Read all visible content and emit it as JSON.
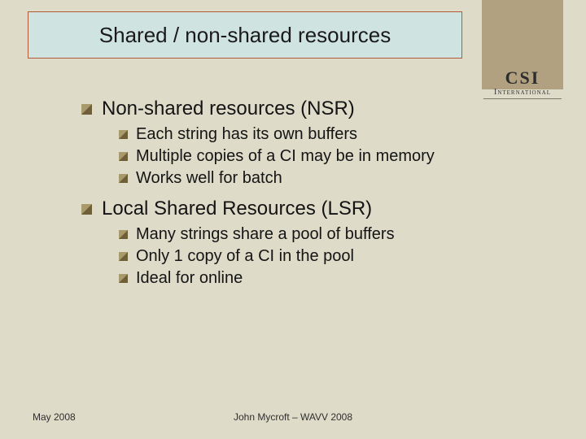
{
  "logo": {
    "main": "CSI",
    "sub": "International"
  },
  "title": "Shared / non-shared resources",
  "sections": [
    {
      "heading": "Non-shared resources (NSR)",
      "items": [
        "Each string has its own buffers",
        "Multiple copies of a CI may be in memory",
        "Works well for batch"
      ]
    },
    {
      "heading": "Local Shared Resources (LSR)",
      "items": [
        "Many strings share a pool of buffers",
        "Only 1 copy of a CI in the pool",
        "Ideal for online"
      ]
    }
  ],
  "footer": {
    "left": "May 2008",
    "center": "John Mycroft – WAVV 2008"
  }
}
